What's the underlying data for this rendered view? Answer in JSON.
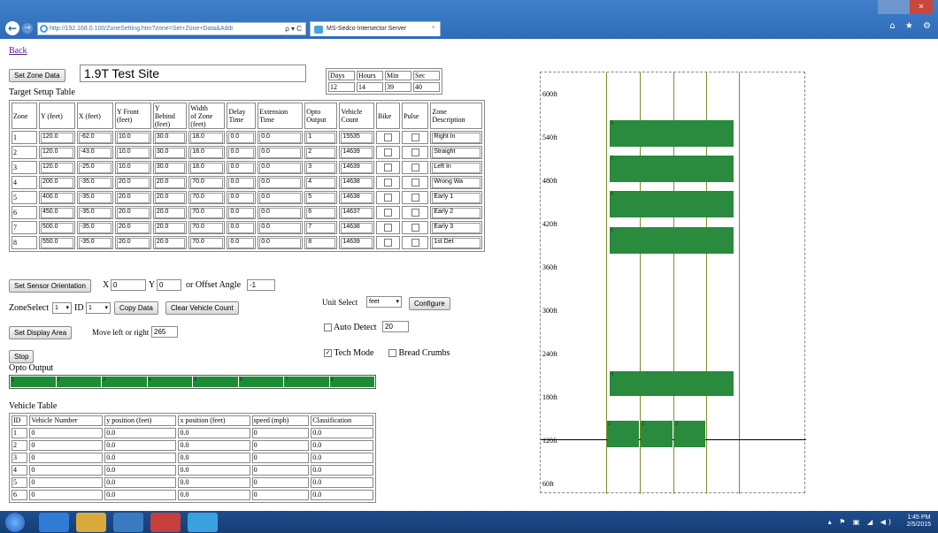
{
  "browser": {
    "address_url": "http://192.168.0.100/ZoneSetting.htm?zone=Set+Zone+Data&Addr",
    "address_controls": "ρ ▾ C",
    "tab_title": "MS-Sedco Intersector Server",
    "tab_close": "×",
    "back_glyph": "←",
    "forward_glyph": "→",
    "toolbar_icons": "⌂ ★ ⚙"
  },
  "page": {
    "back_link": "Back",
    "set_zone_data_button": "Set Zone Data",
    "site_name": "1.9T Test Site",
    "time_headers": [
      "Days",
      "Hours",
      "Min",
      "Sec"
    ],
    "time_values": [
      "12",
      "14",
      "39",
      "40"
    ],
    "target_setup_title": "Target Setup Table"
  },
  "target_table": {
    "headers": [
      "Zone",
      "Y (feet)",
      "X (feet)",
      "Y Front (feet)",
      "Y Behind of Zone (feet)",
      "Width of Zone (feet)",
      "Delay Time",
      "Extension Time",
      "Opto Output",
      "Vehicle Count",
      "Bike",
      "Pulse",
      "Zone Description"
    ],
    "headers_display": [
      [
        "Zone"
      ],
      [
        "Y (feet)"
      ],
      [
        "X (feet)"
      ],
      [
        "Y Front",
        "(feet)"
      ],
      [
        "Y",
        "Behind",
        "(feet)"
      ],
      [
        "Width",
        "of Zone",
        "(feet)"
      ],
      [
        "Delay",
        "Time"
      ],
      [
        "Extension",
        "Time"
      ],
      [
        "Opto",
        "Output"
      ],
      [
        "Vehicle",
        "Count"
      ],
      [
        "Bike"
      ],
      [
        "Pulse"
      ],
      [
        "Zone",
        "Description"
      ]
    ],
    "rows": [
      {
        "zone": "1",
        "y": "120.0",
        "x": "-62.0",
        "yfront": "10.0",
        "ybehind": "30.0",
        "width": "18.0",
        "delay": "0.0",
        "ext": "0.0",
        "opto": "1",
        "count": "15535",
        "desc": "Right In"
      },
      {
        "zone": "2",
        "y": "120.0",
        "x": "-43.0",
        "yfront": "10.0",
        "ybehind": "30.0",
        "width": "18.0",
        "delay": "0.0",
        "ext": "0.0",
        "opto": "2",
        "count": "14639",
        "desc": "Straight"
      },
      {
        "zone": "3",
        "y": "120.0",
        "x": "-25.0",
        "yfront": "10.0",
        "ybehind": "30.0",
        "width": "18.0",
        "delay": "0.0",
        "ext": "0.0",
        "opto": "3",
        "count": "14639",
        "desc": "Left In"
      },
      {
        "zone": "4",
        "y": "200.0",
        "x": "-35.0",
        "yfront": "20.0",
        "ybehind": "20.0",
        "width": "70.0",
        "delay": "0.0",
        "ext": "0.0",
        "opto": "4",
        "count": "14638",
        "desc": "Wrong Wa"
      },
      {
        "zone": "5",
        "y": "400.0",
        "x": "-35.0",
        "yfront": "20.0",
        "ybehind": "20.0",
        "width": "70.0",
        "delay": "0.0",
        "ext": "0.0",
        "opto": "5",
        "count": "14638",
        "desc": "Early 1"
      },
      {
        "zone": "6",
        "y": "450.0",
        "x": "-35.0",
        "yfront": "20.0",
        "ybehind": "20.0",
        "width": "70.0",
        "delay": "0.0",
        "ext": "0.0",
        "opto": "6",
        "count": "14637",
        "desc": "Early 2"
      },
      {
        "zone": "7",
        "y": "500.0",
        "x": "-35.0",
        "yfront": "20.0",
        "ybehind": "20.0",
        "width": "70.0",
        "delay": "0.0",
        "ext": "0.0",
        "opto": "7",
        "count": "14638",
        "desc": "Early 3"
      },
      {
        "zone": "8",
        "y": "550.0",
        "x": "-35.0",
        "yfront": "20.0",
        "ybehind": "20.0",
        "width": "70.0",
        "delay": "0.0",
        "ext": "0.0",
        "opto": "8",
        "count": "14639",
        "desc": "1st Det"
      }
    ]
  },
  "sensor": {
    "orientation_button": "Set Sensor Orientation",
    "x_label": "X",
    "x_value": "0",
    "y_label": "Y",
    "y_value": "0",
    "offset_label": "or Offset Angle",
    "offset_value": "-1"
  },
  "zone_select": {
    "label": "ZoneSelect",
    "value": "1",
    "id_label": "ID",
    "id_value": "1",
    "copy_button": "Copy Data",
    "clear_button": "Clear Vehicle Count"
  },
  "display_area": {
    "button": "Set Display Area",
    "move_label": "Move left or right",
    "move_value": "265"
  },
  "unit": {
    "label": "Unit Select",
    "value": "feet",
    "configure_button": "Configure",
    "auto_detect_label": "Auto Detect",
    "auto_detect_value": "20",
    "auto_detect_checked": false,
    "tech_mode_label": "Tech Mode",
    "tech_mode_checked": true,
    "bread_crumbs_label": "Bread Crumbs",
    "bread_crumbs_checked": false
  },
  "stop_button": "Stop",
  "opto_output": {
    "title": "Opto Output",
    "segments": [
      "1",
      "2",
      "3",
      "4",
      "5",
      "6",
      "7",
      "8"
    ],
    "active_color": "#1e8b35"
  },
  "vehicle_table": {
    "title": "Vehicle Table",
    "headers": [
      "ID",
      "Vehicle Number",
      "y position (feet)",
      "x position (feet)",
      "speed (mph)",
      "Classification"
    ],
    "rows": [
      [
        "1",
        "0",
        "0.0",
        "0.0",
        "0",
        "0.0"
      ],
      [
        "2",
        "0",
        "0.0",
        "0.0",
        "0",
        "0.0"
      ],
      [
        "3",
        "0",
        "0.0",
        "0.0",
        "0",
        "0.0"
      ],
      [
        "4",
        "0",
        "0.0",
        "0.0",
        "0",
        "0.0"
      ],
      [
        "5",
        "0",
        "0.0",
        "0.0",
        "0",
        "0.0"
      ],
      [
        "6",
        "0",
        "0.0",
        "0.0",
        "0",
        "0.0"
      ]
    ]
  },
  "zone_plot": {
    "axis_labels": [
      "600ft",
      "540ft",
      "480ft",
      "420ft",
      "360ft",
      "300ft",
      "240ft",
      "180ft",
      "120ft",
      "60ft"
    ],
    "zone_color": "#2a8a3e",
    "lane_color": "#7a8f27",
    "zones": [
      "8",
      "7",
      "6",
      "5",
      "4",
      "1",
      "2",
      "3"
    ]
  },
  "taskbar": {
    "clock_time": "1:45 PM",
    "clock_date": "2/5/2015",
    "tray_icons": "▴ ⚑ ▣ ◢ ◀)"
  }
}
